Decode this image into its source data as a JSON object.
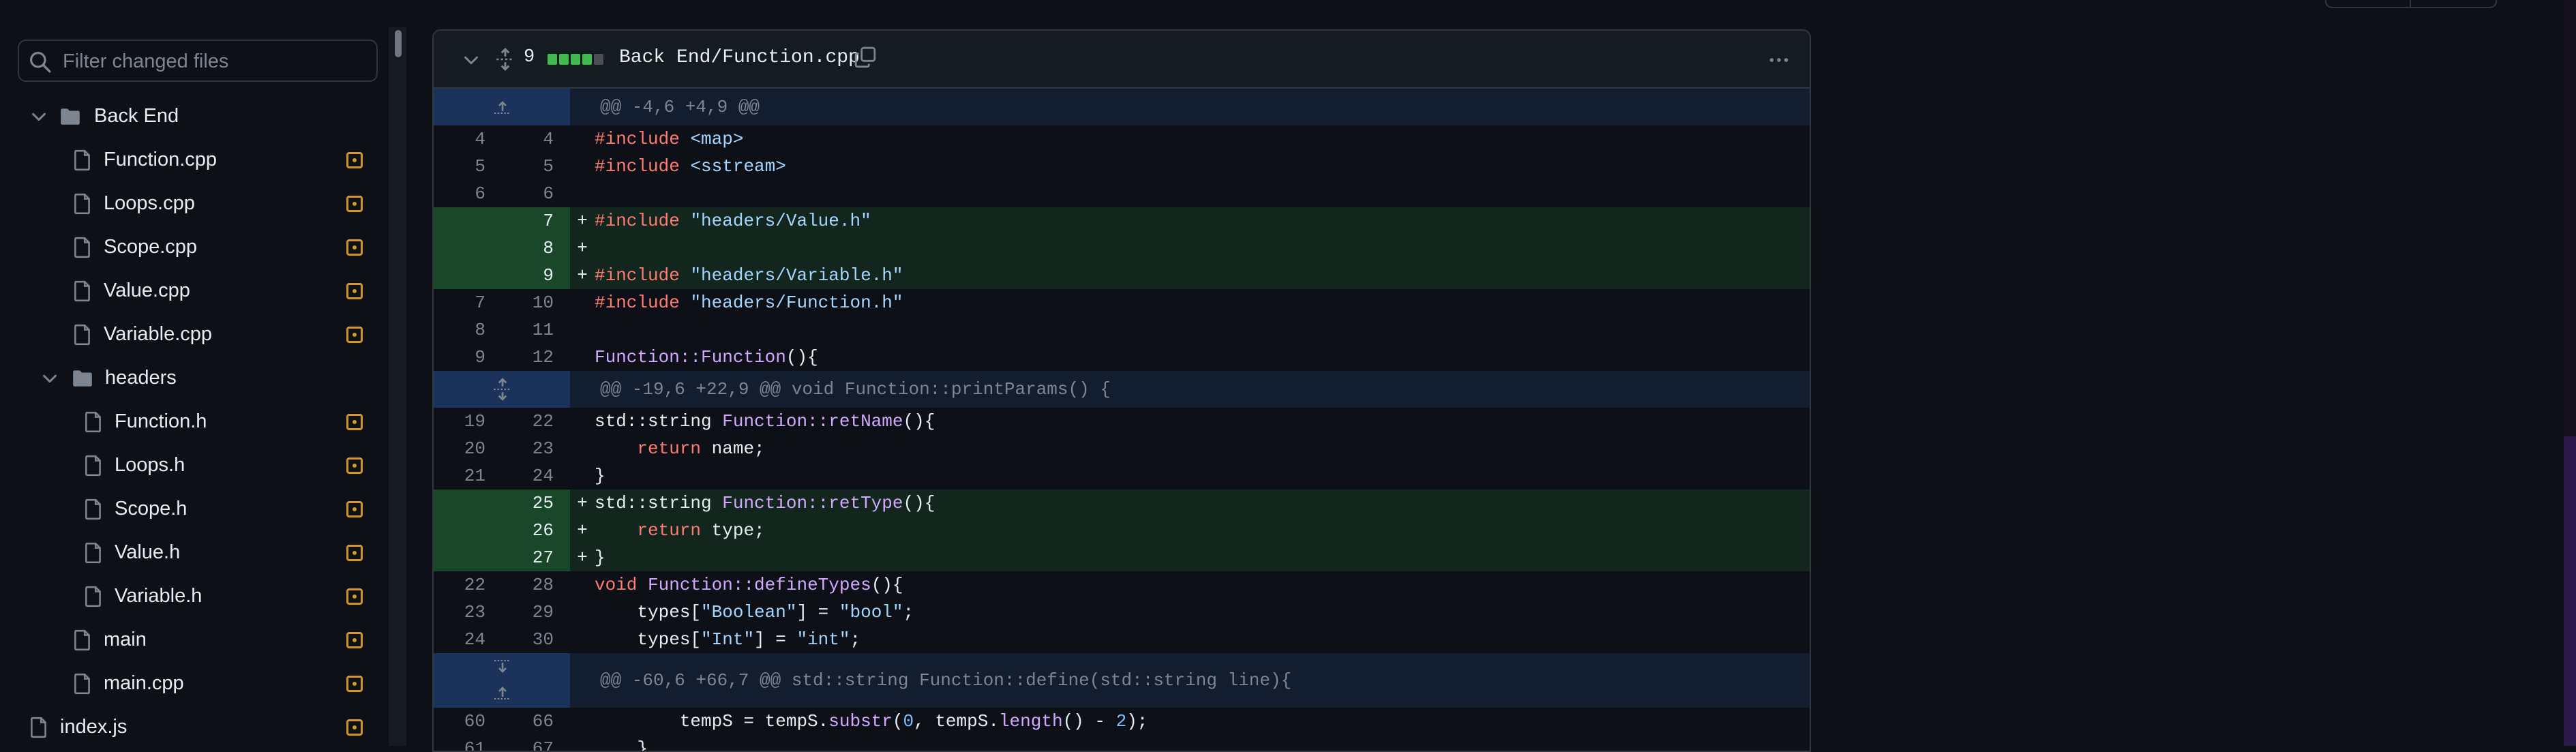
{
  "filter": {
    "placeholder": "Filter changed files"
  },
  "tree": [
    {
      "type": "folder",
      "label": "Back End",
      "level": 0,
      "expanded": true
    },
    {
      "type": "file",
      "label": "Function.cpp",
      "level": 1,
      "status": "modified"
    },
    {
      "type": "file",
      "label": "Loops.cpp",
      "level": 1,
      "status": "modified"
    },
    {
      "type": "file",
      "label": "Scope.cpp",
      "level": 1,
      "status": "modified"
    },
    {
      "type": "file",
      "label": "Value.cpp",
      "level": 1,
      "status": "modified"
    },
    {
      "type": "file",
      "label": "Variable.cpp",
      "level": 1,
      "status": "modified"
    },
    {
      "type": "folder",
      "label": "headers",
      "level": 1,
      "expanded": true
    },
    {
      "type": "file",
      "label": "Function.h",
      "level": 2,
      "status": "modified"
    },
    {
      "type": "file",
      "label": "Loops.h",
      "level": 2,
      "status": "modified"
    },
    {
      "type": "file",
      "label": "Scope.h",
      "level": 2,
      "status": "modified"
    },
    {
      "type": "file",
      "label": "Value.h",
      "level": 2,
      "status": "modified"
    },
    {
      "type": "file",
      "label": "Variable.h",
      "level": 2,
      "status": "modified"
    },
    {
      "type": "file",
      "label": "main",
      "level": 1,
      "status": "modified"
    },
    {
      "type": "file",
      "label": "main.cpp",
      "level": 1,
      "status": "modified"
    },
    {
      "type": "file",
      "label": "index.js",
      "level": 0,
      "status": "modified"
    }
  ],
  "file_header": {
    "change_count": "9",
    "diffstat": [
      "add",
      "add",
      "add",
      "add",
      "neutral"
    ],
    "filename": "Back End/Function.cpp"
  },
  "colors": {
    "add": "#3fb950",
    "neutral": "#484f58",
    "modified": "#d29922"
  },
  "diff": [
    {
      "type": "hunk",
      "text": "@@ -4,6 +4,9 @@",
      "expander": "up"
    },
    {
      "type": "ctx",
      "o": "4",
      "n": "4",
      "tokens": [
        [
          "kw",
          "#include"
        ],
        [
          "p",
          " "
        ],
        [
          "str",
          "<map>"
        ]
      ]
    },
    {
      "type": "ctx",
      "o": "5",
      "n": "5",
      "tokens": [
        [
          "kw",
          "#include"
        ],
        [
          "p",
          " "
        ],
        [
          "str",
          "<sstream>"
        ]
      ]
    },
    {
      "type": "ctx",
      "o": "6",
      "n": "6",
      "tokens": []
    },
    {
      "type": "add",
      "o": "",
      "n": "7",
      "tokens": [
        [
          "kw",
          "#include"
        ],
        [
          "p",
          " "
        ],
        [
          "str",
          "\"headers/Value.h\""
        ]
      ]
    },
    {
      "type": "add",
      "o": "",
      "n": "8",
      "tokens": []
    },
    {
      "type": "add",
      "o": "",
      "n": "9",
      "tokens": [
        [
          "kw",
          "#include"
        ],
        [
          "p",
          " "
        ],
        [
          "str",
          "\"headers/Variable.h\""
        ]
      ]
    },
    {
      "type": "ctx",
      "o": "7",
      "n": "10",
      "tokens": [
        [
          "kw",
          "#include"
        ],
        [
          "p",
          " "
        ],
        [
          "str",
          "\"headers/Function.h\""
        ]
      ]
    },
    {
      "type": "ctx",
      "o": "8",
      "n": "11",
      "tokens": []
    },
    {
      "type": "ctx",
      "o": "9",
      "n": "12",
      "tokens": [
        [
          "fn",
          "Function::Function"
        ],
        [
          "p",
          "(){"
        ]
      ]
    },
    {
      "type": "hunk",
      "text": "@@ -19,6 +22,9 @@ void Function::printParams() {",
      "expander": "both"
    },
    {
      "type": "ctx",
      "o": "19",
      "n": "22",
      "tokens": [
        [
          "p",
          "std::string "
        ],
        [
          "fn",
          "Function::retName"
        ],
        [
          "p",
          "(){"
        ]
      ]
    },
    {
      "type": "ctx",
      "o": "20",
      "n": "23",
      "tokens": [
        [
          "p",
          "    "
        ],
        [
          "kw",
          "return"
        ],
        [
          "p",
          " name;"
        ]
      ]
    },
    {
      "type": "ctx",
      "o": "21",
      "n": "24",
      "tokens": [
        [
          "p",
          "}"
        ]
      ]
    },
    {
      "type": "add",
      "o": "",
      "n": "25",
      "tokens": [
        [
          "p",
          "std::string "
        ],
        [
          "fn",
          "Function::retType"
        ],
        [
          "p",
          "(){"
        ]
      ]
    },
    {
      "type": "add",
      "o": "",
      "n": "26",
      "tokens": [
        [
          "p",
          "    "
        ],
        [
          "kw",
          "return"
        ],
        [
          "p",
          " type;"
        ]
      ]
    },
    {
      "type": "add",
      "o": "",
      "n": "27",
      "tokens": [
        [
          "p",
          "}"
        ]
      ]
    },
    {
      "type": "ctx",
      "o": "22",
      "n": "28",
      "tokens": [
        [
          "kw",
          "void"
        ],
        [
          "p",
          " "
        ],
        [
          "fn",
          "Function::defineTypes"
        ],
        [
          "p",
          "(){"
        ]
      ]
    },
    {
      "type": "ctx",
      "o": "23",
      "n": "29",
      "tokens": [
        [
          "p",
          "    types["
        ],
        [
          "str",
          "\"Boolean\""
        ],
        [
          "p",
          "] = "
        ],
        [
          "str",
          "\"bool\""
        ],
        [
          "p",
          ";"
        ]
      ]
    },
    {
      "type": "ctx",
      "o": "24",
      "n": "30",
      "tokens": [
        [
          "p",
          "    types["
        ],
        [
          "str",
          "\"Int\""
        ],
        [
          "p",
          "] = "
        ],
        [
          "str",
          "\"int\""
        ],
        [
          "p",
          ";"
        ]
      ]
    },
    {
      "type": "hunk",
      "text": "@@ -60,6 +66,7 @@ std::string Function::define(std::string line){",
      "expander": "split"
    },
    {
      "type": "ctx",
      "o": "60",
      "n": "66",
      "tokens": [
        [
          "p",
          "        tempS = tempS."
        ],
        [
          "fn",
          "substr"
        ],
        [
          "p",
          "("
        ],
        [
          "num",
          "0"
        ],
        [
          "p",
          ", tempS."
        ],
        [
          "fn",
          "length"
        ],
        [
          "p",
          "() - "
        ],
        [
          "num",
          "2"
        ],
        [
          "p",
          ");"
        ]
      ]
    },
    {
      "type": "ctx",
      "o": "61",
      "n": "67",
      "tokens": [
        [
          "p",
          "    }"
        ]
      ]
    }
  ]
}
